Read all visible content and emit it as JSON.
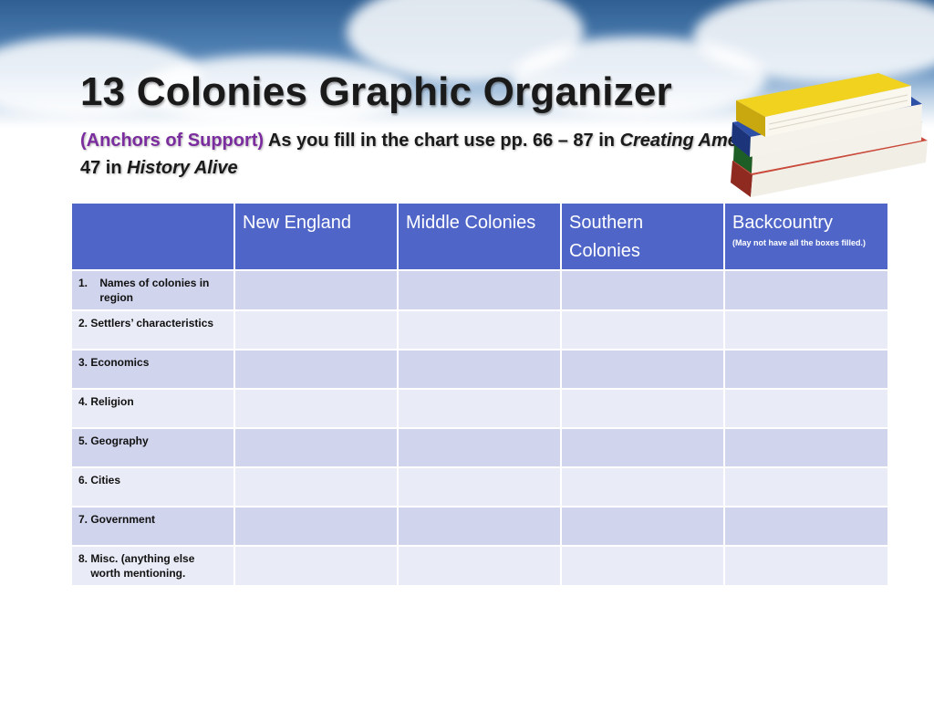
{
  "header": {
    "title": "13 Colonies Graphic Organizer",
    "subtitle_anchor": "(Anchors of Support)",
    "subtitle_text_1": " As you fill in the chart use pp. 66 – 87 in ",
    "subtitle_book_1": "Creating America",
    "subtitle_text_2": " or pp. 35 – 47 in ",
    "subtitle_book_2": "History Alive"
  },
  "colors": {
    "header_blue": "#4f66c8",
    "row_dark": "#d0d4ed",
    "row_light": "#e9ebf6",
    "anchor_purple": "#7b2c9e"
  },
  "table": {
    "columns": [
      {
        "label": ""
      },
      {
        "label": "New England"
      },
      {
        "label": "Middle Colonies"
      },
      {
        "label": "Southern Colonies"
      },
      {
        "label": "Backcountry",
        "note": "(May not have all the boxes filled.)"
      }
    ],
    "rows": [
      {
        "label": "1.    Names of colonies in\n       region"
      },
      {
        "label": "2. Settlers’ characteristics"
      },
      {
        "label": "3. Economics"
      },
      {
        "label": "4. Religion"
      },
      {
        "label": "5. Geography"
      },
      {
        "label": "6. Cities"
      },
      {
        "label": "7. Government"
      },
      {
        "label": "8. Misc. (anything else\n    worth mentioning."
      }
    ]
  },
  "decorations": {
    "books_icon": "stacked-books-icon"
  }
}
